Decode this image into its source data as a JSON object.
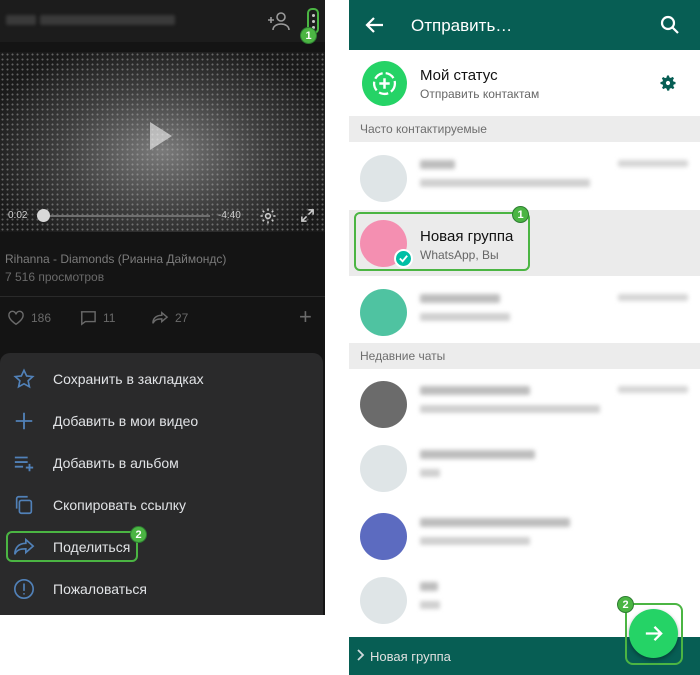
{
  "vk": {
    "video": {
      "time_current": "0:02",
      "time_remaining": "-4:40",
      "progress_fraction": 0.01,
      "title": "Rihanna - Diamonds (Рианна Даймондс)",
      "views": "7 516 просмотров"
    },
    "stats": {
      "likes": "186",
      "comments": "11",
      "reposts": "27"
    },
    "menu": [
      {
        "icon": "star-icon",
        "label": "Сохранить в закладках"
      },
      {
        "icon": "plus-icon",
        "label": "Добавить в мои видео"
      },
      {
        "icon": "playlist-add-icon",
        "label": "Добавить в альбом"
      },
      {
        "icon": "copy-icon",
        "label": "Скопировать ссылку"
      },
      {
        "icon": "share-icon",
        "label": "Поделиться"
      },
      {
        "icon": "report-icon",
        "label": "Пожаловаться"
      }
    ],
    "badges": {
      "more": "1",
      "share": "2"
    }
  },
  "wa": {
    "header_title": "Отправить…",
    "status": {
      "name": "Мой статус",
      "subtitle": "Отправить контактам"
    },
    "section_frequent": "Часто контактируемые",
    "group": {
      "name": "Новая группа",
      "subtitle": "WhatsApp, Вы"
    },
    "section_recent": "Недавние чаты",
    "bottom_selected": "Новая группа",
    "badges": {
      "group": "1",
      "send": "2"
    },
    "colors": {
      "header": "#075e54",
      "accent": "#25d366",
      "highlight": "#4bb543"
    }
  }
}
